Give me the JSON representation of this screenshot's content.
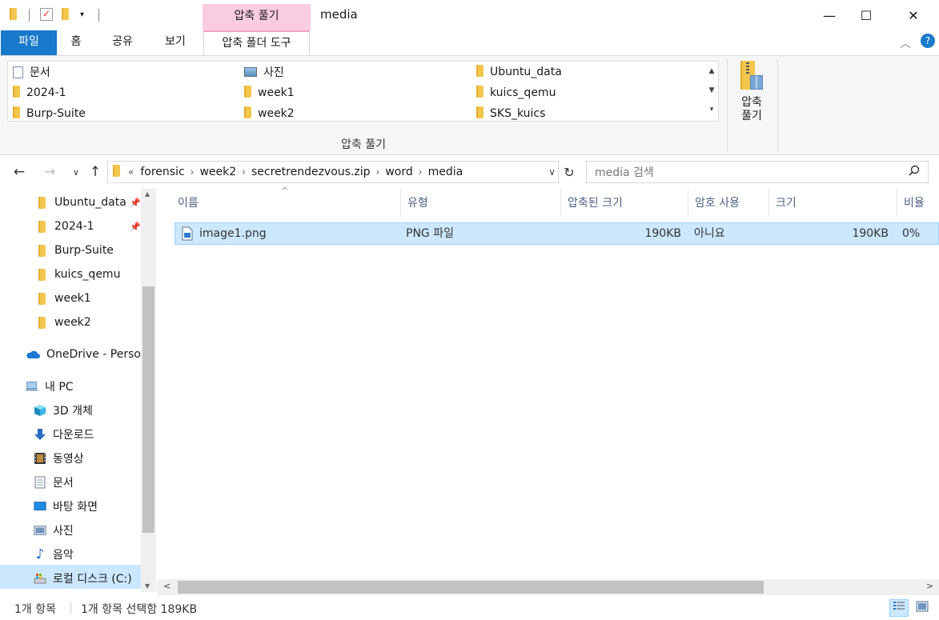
{
  "window": {
    "title": "media",
    "contextual_tab_header": "압축 풀기",
    "minimize": "—",
    "maximize": "☐",
    "close": "✕"
  },
  "ribbon": {
    "tabs": [
      {
        "label": "파일"
      },
      {
        "label": "홈"
      },
      {
        "label": "공유"
      },
      {
        "label": "보기"
      },
      {
        "label": "압축 폴더 도구"
      }
    ],
    "extract_to_items": [
      {
        "label": "문서",
        "icon": "document-icon"
      },
      {
        "label": "사진",
        "icon": "pictures-icon"
      },
      {
        "label": "Ubuntu_data",
        "icon": "folder-icon"
      },
      {
        "label": "2024-1",
        "icon": "folder-icon"
      },
      {
        "label": "week1",
        "icon": "folder-icon"
      },
      {
        "label": "kuics_qemu",
        "icon": "folder-icon"
      },
      {
        "label": "Burp-Suite",
        "icon": "folder-icon"
      },
      {
        "label": "week2",
        "icon": "folder-icon"
      },
      {
        "label": "SKS_kuics",
        "icon": "folder-icon"
      }
    ],
    "group_label": "압축 풀기",
    "extract_all_line1": "압축",
    "extract_all_line2": "풀기"
  },
  "address": {
    "overflow": "«",
    "crumbs": [
      "forensic",
      "week2",
      "secretrendezvous.zip",
      "word",
      "media"
    ],
    "search_placeholder": "media 검색"
  },
  "sidebar": {
    "quick_access": [
      {
        "label": "Ubuntu_data",
        "pinned": true
      },
      {
        "label": "2024-1",
        "pinned": true
      },
      {
        "label": "Burp-Suite",
        "pinned": false
      },
      {
        "label": "kuics_qemu",
        "pinned": false
      },
      {
        "label": "week1",
        "pinned": false
      },
      {
        "label": "week2",
        "pinned": false
      }
    ],
    "onedrive": "OneDrive - Personal",
    "this_pc": "내 PC",
    "pc_items": [
      {
        "label": "3D 개체",
        "icon": "3d-objects-icon"
      },
      {
        "label": "다운로드",
        "icon": "download-icon"
      },
      {
        "label": "동영상",
        "icon": "videos-icon"
      },
      {
        "label": "문서",
        "icon": "document-icon"
      },
      {
        "label": "바탕 화면",
        "icon": "desktop-icon"
      },
      {
        "label": "사진",
        "icon": "pictures-icon"
      },
      {
        "label": "음악",
        "icon": "music-icon"
      },
      {
        "label": "로컬 디스크 (C:)",
        "icon": "local-disk-icon"
      }
    ]
  },
  "columns": {
    "name": "이름",
    "type": "유형",
    "compressed_size": "압축된 크기",
    "password": "암호 사용",
    "size": "크기",
    "ratio": "비율"
  },
  "files": [
    {
      "name": "image1.png",
      "type": "PNG 파일",
      "compressed_size": "190KB",
      "password": "아니요",
      "size": "190KB",
      "ratio": "0%"
    }
  ],
  "status": {
    "count": "1개 항목",
    "selection": "1개 항목 선택함 189KB"
  }
}
